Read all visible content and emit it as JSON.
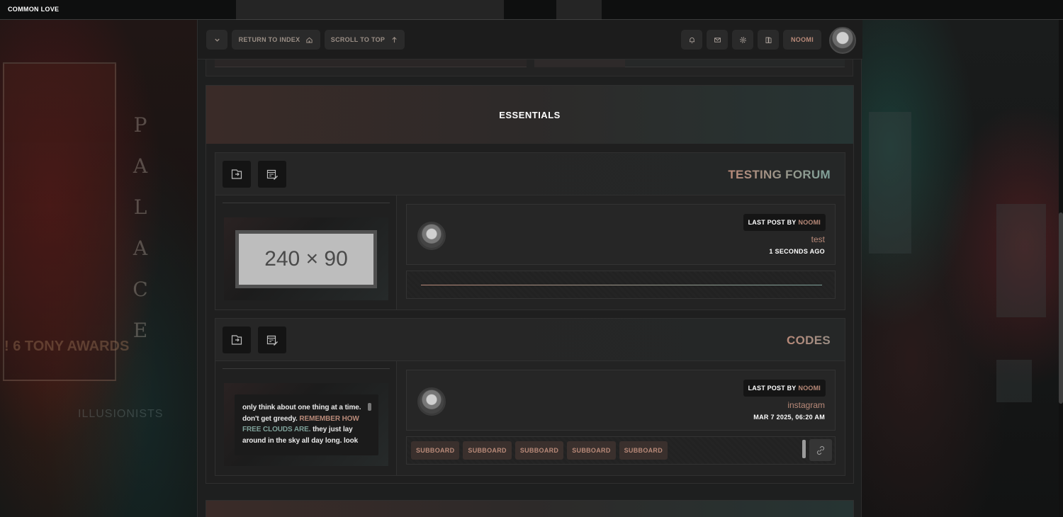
{
  "site": {
    "title": "COMMON LOVE"
  },
  "toolbar": {
    "return_label": "RETURN TO INDEX",
    "scroll_label": "SCROLL TO TOP",
    "username": "NOOMI"
  },
  "category": {
    "title": "ESSENTIALS"
  },
  "forums": [
    {
      "title": "TESTING FORUM",
      "image_placeholder": "240 × 90",
      "lastpost": {
        "prefix": "LAST POST BY",
        "user": "NOOMI",
        "topic": "test",
        "time": "1 SECONDS AGO"
      }
    },
    {
      "title": "CODES",
      "quote": {
        "part1": "only think about one thing at a time. don't get greedy.",
        "highlight1": "REMEMBER HOW",
        "highlight2": "FREE CLOUDS ARE.",
        "part2": "they just lay around in the sky all day long. look"
      },
      "lastpost": {
        "prefix": "LAST POST BY",
        "user": "NOOMI",
        "topic": "instagram",
        "time": "MAR 7 2025, 06:20 AM"
      },
      "subboards": [
        "SUBBOARD",
        "SUBBOARD",
        "SUBBOARD",
        "SUBBOARD",
        "SUBBOARD"
      ]
    }
  ],
  "background": {
    "left_sign": "P A L A C E",
    "left_awards": "! 6 TONY AWARDS",
    "left_show": "ILLUSIONISTS"
  },
  "colors": {
    "accent_warm": "#b98a79",
    "accent_cool": "#7fa29a",
    "panel": "#232323"
  }
}
